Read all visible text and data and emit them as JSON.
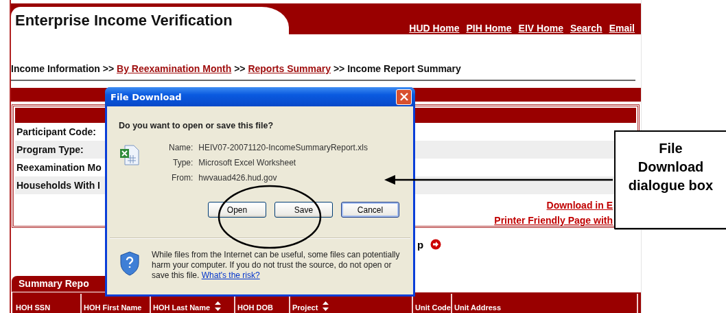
{
  "header": {
    "title": "Enterprise Income Verification",
    "nav_links": [
      "HUD Home",
      "PIH Home",
      "EIV Home",
      "Search",
      "Email"
    ]
  },
  "breadcrumb": [
    {
      "kind": "text",
      "text": "Income Information >> "
    },
    {
      "kind": "link",
      "text": "By Reexamination Month"
    },
    {
      "kind": "text",
      "text": " >> "
    },
    {
      "kind": "link",
      "text": "Reports Summary"
    },
    {
      "kind": "text",
      "text": " >> Income Report Summary"
    }
  ],
  "details": {
    "rows": [
      {
        "label": "Participant Code:"
      },
      {
        "label": "Program Type:"
      },
      {
        "label": "Reexamination Mo"
      },
      {
        "label": "Households With I"
      }
    ],
    "links": [
      "Download in E",
      "Printer Friendly Page with"
    ]
  },
  "next_row": {
    "text": "p"
  },
  "summary": {
    "title": "Summary Repo",
    "columns": [
      {
        "label": "HOH SSN",
        "sortable": false
      },
      {
        "label": "HOH First Name",
        "sortable": false
      },
      {
        "label": "HOH Last Name",
        "sortable": true
      },
      {
        "label": "HOH DOB",
        "sortable": false
      },
      {
        "label": "Project",
        "sortable": true
      },
      {
        "label": "Unit Code",
        "sortable": false
      },
      {
        "label": "Unit Address",
        "sortable": false
      }
    ]
  },
  "dialog": {
    "title": "File Download",
    "question": "Do you want to open or save this file?",
    "info": [
      {
        "label": "Name:",
        "value": "HEIV07-20071120-IncomeSummaryReport.xls"
      },
      {
        "label": "Type:",
        "value": "Microsoft Excel Worksheet"
      },
      {
        "label": "From:",
        "value": "hwvauad426.hud.gov"
      }
    ],
    "buttons": [
      {
        "label": "Open",
        "focused": false
      },
      {
        "label": "Save",
        "focused": false
      },
      {
        "label": "Cancel",
        "focused": true
      }
    ],
    "warning": "While files from the Internet can be useful, some files can potentially harm your computer. If you do not trust the source, do not open or save this file. ",
    "warning_link": "What's the risk?"
  },
  "callout": {
    "text": "File Download dialogue box"
  }
}
